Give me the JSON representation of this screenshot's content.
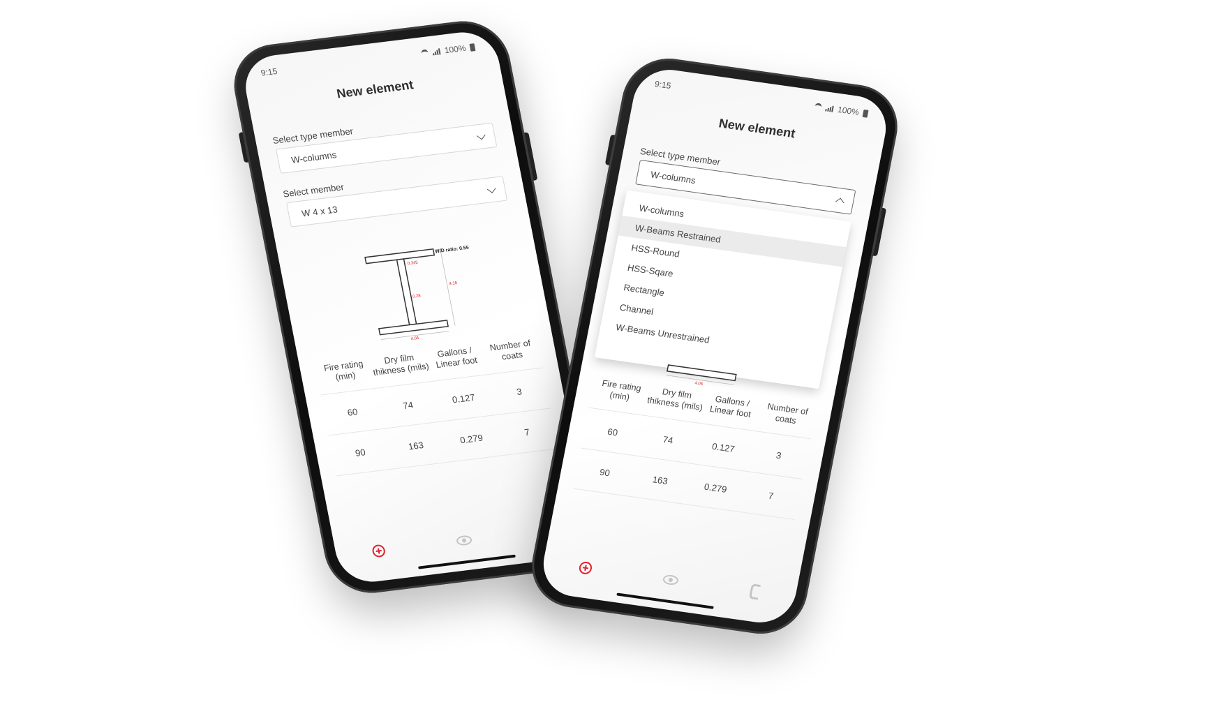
{
  "status": {
    "time": "9:15",
    "battery": "100%"
  },
  "title": "New element",
  "type_member": {
    "label": "Select type member",
    "value": "W-columns"
  },
  "member": {
    "label": "Select member",
    "value": "W 4 x 13"
  },
  "diagram": {
    "ratio": "W/D ratio: 0.55",
    "flange_thickness": "0.345",
    "web_thickness": "0.28",
    "depth": "4.16",
    "width": "4.06"
  },
  "table": {
    "headers": [
      "Fire rating (min)",
      "Dry film thikness (mils)",
      "Gallons / Linear foot",
      "Number of coats"
    ],
    "rows": [
      [
        "60",
        "74",
        "0.127",
        "3"
      ],
      [
        "90",
        "163",
        "0.279",
        "7"
      ]
    ]
  },
  "dropdown_options": [
    "W-columns",
    "W-Beams Restrained",
    "HSS-Round",
    "HSS-Sqare",
    "Rectangle",
    "Channel",
    "W-Beams Unrestrained"
  ],
  "highlighted_option": "W-Beams Restrained",
  "nav": {
    "icons": [
      "plus-circle-icon",
      "eye-icon",
      "phone-icon"
    ],
    "active_color": "#e0222b"
  }
}
